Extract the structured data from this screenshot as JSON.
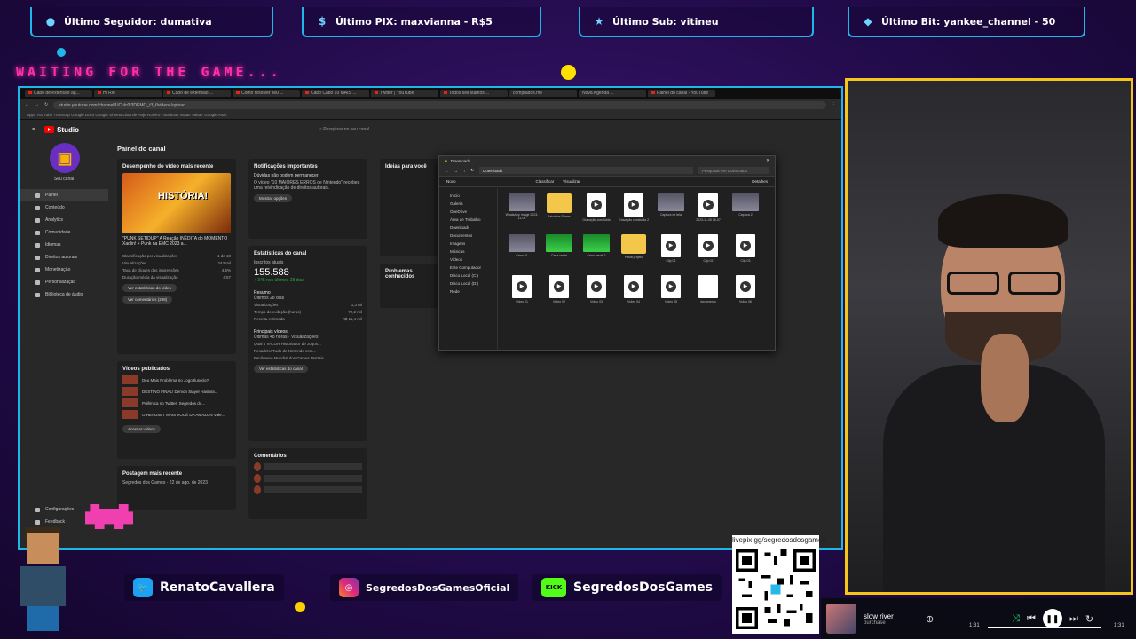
{
  "alerts": {
    "follower": "Último Seguidor: dumativa",
    "pix": "Último PIX: maxvianna - R$5",
    "sub": "Último Sub: vitineu",
    "bit": "Último Bit: yankee_channel - 50"
  },
  "waiting_text": "WAITING FOR THE GAME...",
  "browser": {
    "tabs": [
      "Cabo de extensão ag...",
      "Hi Rio",
      "Cabo de extensão ...",
      "Como resolver seu ...",
      "Cabo Cabo 10 MAIS ...",
      "Twitter | YouTube",
      "Todos sell stamos ...",
      "comprados.me",
      "Nova Agenda ...",
      "Painel do canal - YouTube"
    ],
    "url": "studio.youtube.com/channel/UCvIc0t3DEMO_t3_f/videos/upload",
    "bookmarks": "Apps  YouTube  Transcrip  Google Docs  Google Sheets  Lista de Hoje  Roteiro  Facebook  Notas  Twitter  Google Anal."
  },
  "studio": {
    "logo": "Studio",
    "search_placeholder": "Pesquisar no seu canal",
    "channel_name": "Seu canal",
    "page_title": "Painel do canal",
    "nav": [
      "Painel",
      "Conteúdo",
      "Analytics",
      "Comunidade",
      "Idiomas",
      "Direitos autorais",
      "Monetização",
      "Personalização",
      "Biblioteca de áudio"
    ],
    "settings": "Configurações",
    "feedback": "Feedback",
    "recent_title": "Desempenho do vídeo mais recente",
    "thumb_text": "HISTÓRIA!",
    "video_title": "\"PUNK SETIDUP\" A Reação INÉDITA do MOMENTO Xaolin! + Punk na EMC 2023 a...",
    "stats_rows": [
      [
        "Classificação por visualizações",
        "1 de 10"
      ],
      [
        "Visualizações",
        "243 mil"
      ],
      [
        "Taxa de cliques das impressões",
        "4,6%"
      ],
      [
        "Duração média da visualização",
        "4:57"
      ]
    ],
    "btn_analytics": "Ver estatísticas do vídeo",
    "btn_comments": "Ver comentários (298)",
    "published_title": "Vídeos publicados",
    "published": [
      "Deu Mais Problema no Jogo Ilusório?",
      "DESTINO FINAL! Demon Slayer Hashira...",
      "Polêmica no Twitter! Segredos do...",
      "O HEADSET MAIS VOCÊ DA AMAZON Vale..."
    ],
    "btn_goto_videos": "Acessar vídeos",
    "last_title": "Postagem mais recente",
    "last_sub": "Segredos dos Games · 22 de ago. de 2023",
    "notif_title": "Notificações importantes",
    "notif_head": "Dúvidas não podem permanecer",
    "notif_body": "O vídeo \"10 MAIORES ERROS de Nintendo\" recebeu uma reivindicação de direitos autorais.",
    "btn_notif": "Mostrar opções",
    "channel_stats_title": "Estatísticas do canal",
    "subs_label": "Inscritos atuais",
    "subs_value": "155.588",
    "subs_delta": "+ 345 nos últimos 28 dias",
    "summary_title": "Resumo",
    "summary_sub": "Últimos 28 dias",
    "summary_rows": [
      [
        "Visualizações",
        "1,3 mi"
      ],
      [
        "Tempo de exibição (horas)",
        "72,2 mil"
      ],
      [
        "Receita estimada",
        "R$ 11,4 mil"
      ]
    ],
    "top_title": "Principais vídeos",
    "top_sub": "Últimas 48 horas · Visualizações",
    "top_rows": [
      "Qual o VALOR Historiador de Jogos...",
      "Pesadelo! Tudo de Nintendo com...",
      "Fenômeno Mundial dos Games Mortais..."
    ],
    "btn_channel_stats": "Ver estatísticas do canal",
    "comments_title": "Comentários",
    "ideas_title": "Ideias para você",
    "problems_title": "Problemas conhecidos"
  },
  "explorer": {
    "title": "Downloads",
    "address": "Downloads",
    "search_placeholder": "Pesquisar em Downloads",
    "new": "Novo",
    "sort": "Classificar",
    "view": "Visualizar",
    "details": "Detalhes",
    "left": [
      "Início",
      "Galeria",
      "OneDrive",
      "Área de Trabalho",
      "Downloads",
      "Documentos",
      "Imagens",
      "Músicas",
      "Vídeos",
      "Este Computador",
      "Disco Local (C:)",
      "Disco Local (D:)",
      "Rede"
    ],
    "files": [
      [
        "img",
        "WhatsApp Image 2023-11-05"
      ],
      [
        "folder",
        "Baixados Filmes"
      ],
      [
        "video",
        "Gravação concluída"
      ],
      [
        "video",
        "Gravação concluída 2"
      ],
      [
        "img",
        "Captura de tela"
      ],
      [
        "video",
        "2023-11-05 16-07"
      ],
      [
        "img",
        "Captura 2"
      ],
      [
        "img",
        "Cena 01"
      ],
      [
        "green",
        "Cena verde"
      ],
      [
        "green",
        "Cena verde 2"
      ],
      [
        "folder",
        "Pasta projeto"
      ],
      [
        "video",
        "Clip 01"
      ],
      [
        "video",
        "Clip 02"
      ],
      [
        "video",
        "Clip 03"
      ],
      [
        "video",
        "Vídeo 01"
      ],
      [
        "video",
        "Vídeo 02"
      ],
      [
        "video",
        "Vídeo 03"
      ],
      [
        "video",
        "Vídeo 04"
      ],
      [
        "video",
        "Vídeo 05"
      ],
      [
        "blank",
        "documento"
      ],
      [
        "video",
        "Vídeo 06"
      ]
    ]
  },
  "social": {
    "twitter": "RenatoCavallera",
    "instagram": "SegredosDosGamesOficial",
    "kick_badge": "KICK",
    "kick": "SegredosDosGames"
  },
  "qr_label": "livepix.gg/segredosdosgames",
  "player": {
    "track": "slow river",
    "artist": "ourchase",
    "elapsed": "1:31",
    "duration": "1:31",
    "progress": 1.0
  }
}
